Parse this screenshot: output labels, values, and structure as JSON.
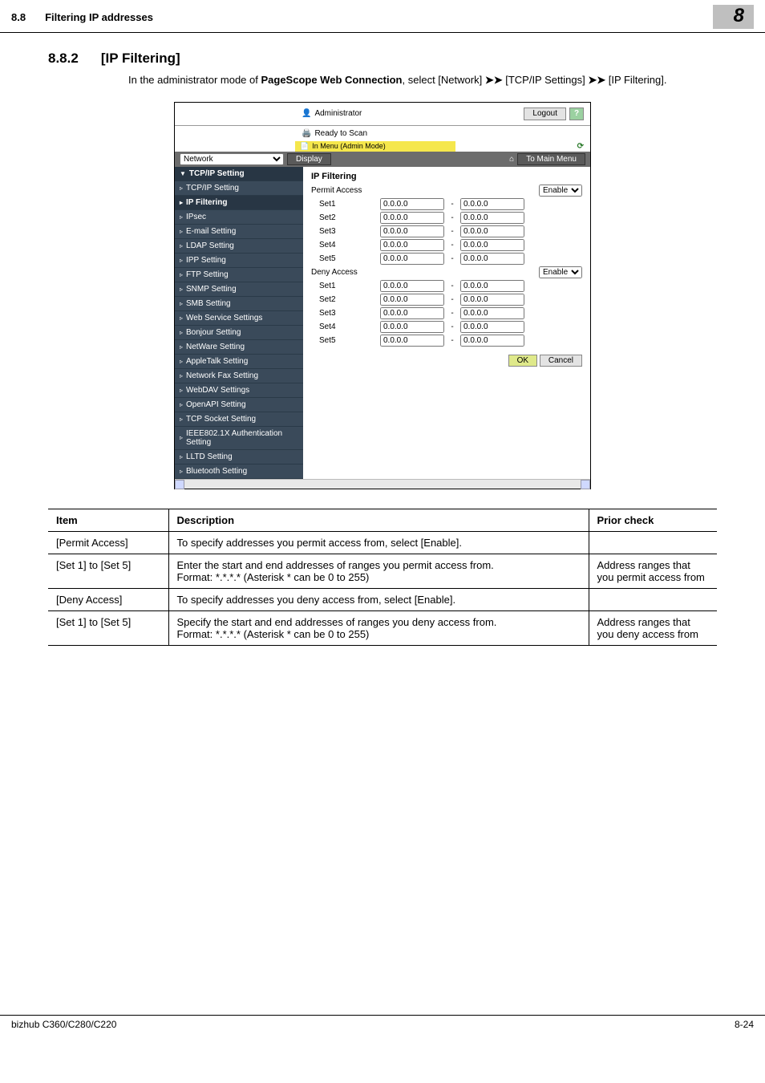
{
  "header": {
    "section_number": "8.8",
    "section_title": "Filtering IP addresses",
    "chapter_badge": "8"
  },
  "heading": {
    "number": "8.8.2",
    "title": "[IP Filtering]"
  },
  "intro": {
    "before": "In the administrator mode of ",
    "bold": "PageScope Web Connection",
    "mid": ", select [Network] ",
    "arrow1": "➤➤",
    "part2": " [TCP/IP Settings] ",
    "arrow2": "➤➤",
    "part3": " [IP Filtering]."
  },
  "screenshot": {
    "admin_label": "Administrator",
    "logout": "Logout",
    "help": "?",
    "ready": "Ready to Scan",
    "menu_mode": "In Menu (Admin Mode)",
    "network_select": "Network",
    "display_btn": "Display",
    "to_main": "To Main Menu",
    "nav": [
      {
        "label": "TCP/IP Setting",
        "active": true,
        "disclosure": "▼"
      },
      {
        "label": "TCP/IP Setting",
        "active": false,
        "disclosure": "▹"
      },
      {
        "label": "IP Filtering",
        "active": true,
        "disclosure": "▸"
      },
      {
        "label": "IPsec",
        "active": false,
        "disclosure": "▹"
      },
      {
        "label": "E-mail Setting",
        "active": false,
        "disclosure": "▹"
      },
      {
        "label": "LDAP Setting",
        "active": false,
        "disclosure": "▹"
      },
      {
        "label": "IPP Setting",
        "active": false,
        "disclosure": "▹"
      },
      {
        "label": "FTP Setting",
        "active": false,
        "disclosure": "▹"
      },
      {
        "label": "SNMP Setting",
        "active": false,
        "disclosure": "▹"
      },
      {
        "label": "SMB Setting",
        "active": false,
        "disclosure": "▹"
      },
      {
        "label": "Web Service Settings",
        "active": false,
        "disclosure": "▹"
      },
      {
        "label": "Bonjour Setting",
        "active": false,
        "disclosure": "▹"
      },
      {
        "label": "NetWare Setting",
        "active": false,
        "disclosure": "▹"
      },
      {
        "label": "AppleTalk Setting",
        "active": false,
        "disclosure": "▹"
      },
      {
        "label": "Network Fax Setting",
        "active": false,
        "disclosure": "▹"
      },
      {
        "label": "WebDAV Settings",
        "active": false,
        "disclosure": "▹"
      },
      {
        "label": "OpenAPI Setting",
        "active": false,
        "disclosure": "▹"
      },
      {
        "label": "TCP Socket Setting",
        "active": false,
        "disclosure": "▹"
      },
      {
        "label": "IEEE802.1X Authentication Setting",
        "active": false,
        "disclosure": "▹"
      },
      {
        "label": "LLTD Setting",
        "active": false,
        "disclosure": "▹"
      },
      {
        "label": "Bluetooth Setting",
        "active": false,
        "disclosure": "▹"
      }
    ],
    "panel_title": "IP Filtering",
    "permit_label": "Permit Access",
    "deny_label": "Deny Access",
    "enable_option": "Enable",
    "sets": [
      {
        "label": "Set1",
        "from": "0.0.0.0",
        "to": "0.0.0.0"
      },
      {
        "label": "Set2",
        "from": "0.0.0.0",
        "to": "0.0.0.0"
      },
      {
        "label": "Set3",
        "from": "0.0.0.0",
        "to": "0.0.0.0"
      },
      {
        "label": "Set4",
        "from": "0.0.0.0",
        "to": "0.0.0.0"
      },
      {
        "label": "Set5",
        "from": "0.0.0.0",
        "to": "0.0.0.0"
      }
    ],
    "deny_sets": [
      {
        "label": "Set1",
        "from": "0.0.0.0",
        "to": "0.0.0.0"
      },
      {
        "label": "Set2",
        "from": "0.0.0.0",
        "to": "0.0.0.0"
      },
      {
        "label": "Set3",
        "from": "0.0.0.0",
        "to": "0.0.0.0"
      },
      {
        "label": "Set4",
        "from": "0.0.0.0",
        "to": "0.0.0.0"
      },
      {
        "label": "Set5",
        "from": "0.0.0.0",
        "to": "0.0.0.0"
      }
    ],
    "ok": "OK",
    "cancel": "Cancel"
  },
  "table": {
    "headers": {
      "item": "Item",
      "desc": "Description",
      "prior": "Prior check"
    },
    "rows": [
      {
        "item": "[Permit Access]",
        "desc": "To specify addresses you permit access from, select [Enable].",
        "prior": ""
      },
      {
        "item": "[Set 1] to [Set 5]",
        "desc": "Enter the start and end addresses of ranges you permit access from.\nFormat: *.*.*.* (Asterisk * can be 0 to 255)",
        "prior": "Address ranges that you permit access from"
      },
      {
        "item": "[Deny Access]",
        "desc": "To specify addresses you deny access from, select [Enable].",
        "prior": ""
      },
      {
        "item": "[Set 1] to [Set 5]",
        "desc": "Specify the start and end addresses of ranges you deny access from.\nFormat: *.*.*.* (Asterisk * can be 0 to 255)",
        "prior": "Address ranges that you deny access from"
      }
    ]
  },
  "footer": {
    "model": "bizhub C360/C280/C220",
    "page": "8-24"
  }
}
